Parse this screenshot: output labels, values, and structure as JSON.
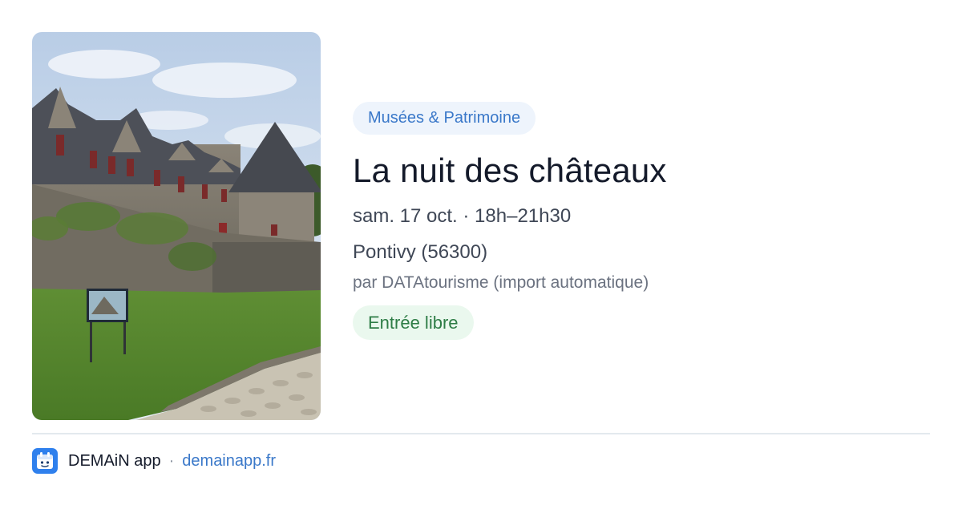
{
  "event": {
    "category": "Musées & Patrimoine",
    "title": "La nuit des châteaux",
    "datetime": "sam. 17 oct. · 18h–21h30",
    "place": "Pontivy (56300)",
    "organizer": "par DATAtourisme (import automatique)",
    "price": "Entrée libre"
  },
  "footer": {
    "app_name": "DEMAiN app",
    "separator": "·",
    "app_url": "demainapp.fr"
  },
  "colors": {
    "accent": "#3a78c9",
    "category_bg": "#eef4fc",
    "price_text": "#2e7d46",
    "price_bg": "#eaf8ee",
    "app_icon": "#2f80ed"
  },
  "icons": {
    "app_icon": "calendar-face-icon"
  }
}
